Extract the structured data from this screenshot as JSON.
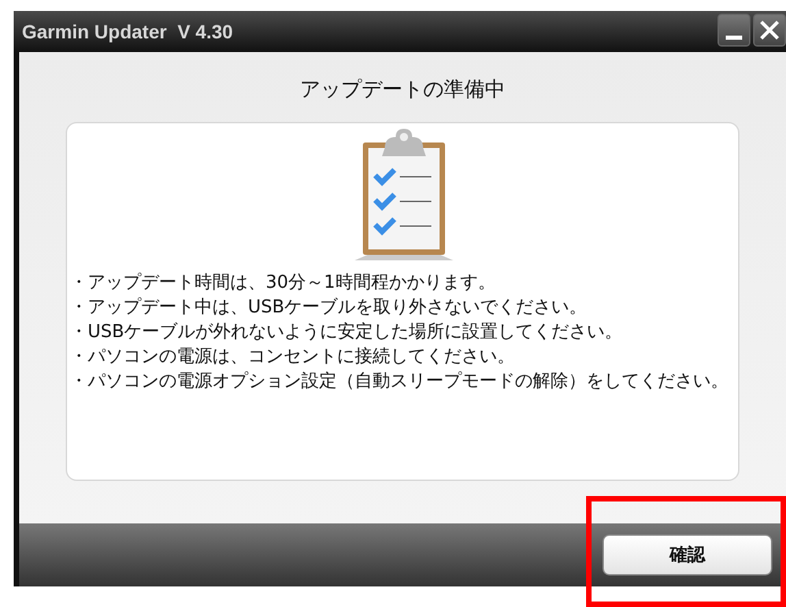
{
  "window": {
    "title": "Garmin Updater  V 4.30"
  },
  "heading": "アップデートの準備中",
  "notes": [
    "・アップデート時間は、30分～1時間程かかります。",
    "・アップデート中は、USBケーブルを取り外さないでください。",
    "・USBケーブルが外れないように安定した場所に設置してください。",
    "・パソコンの電源は、コンセントに接続してください。",
    "・パソコンの電源オプション設定（自動スリープモードの解除）をしてください。"
  ],
  "confirm_button": "確認"
}
